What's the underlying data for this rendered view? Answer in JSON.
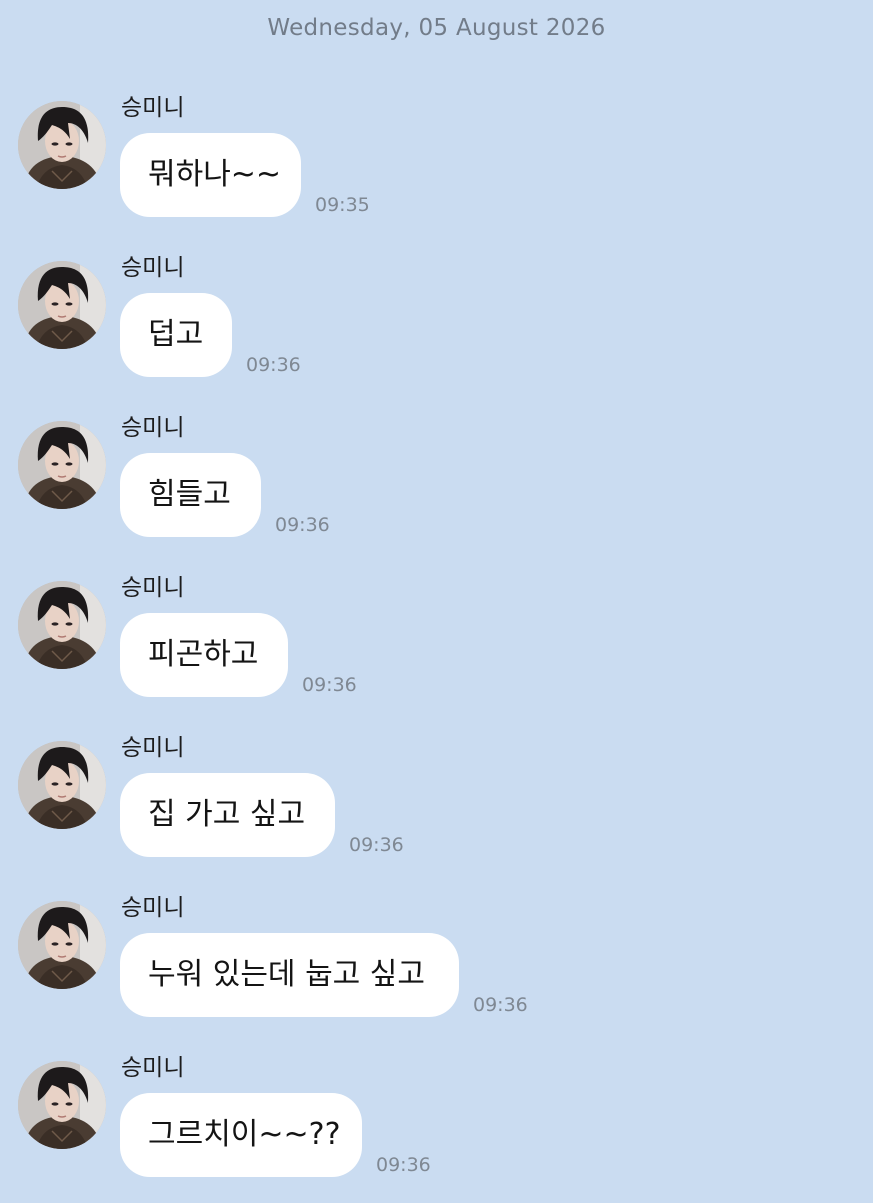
{
  "chat": {
    "date_label": "Wednesday, 05 August 2026",
    "messages": [
      {
        "sender": "승미니",
        "text": "뭐하나~~",
        "time": "09:35"
      },
      {
        "sender": "승미니",
        "text": "덥고",
        "time": "09:36"
      },
      {
        "sender": "승미니",
        "text": "힘들고",
        "time": "09:36"
      },
      {
        "sender": "승미니",
        "text": "피곤하고",
        "time": "09:36"
      },
      {
        "sender": "승미니",
        "text": "집 가고 싶고",
        "time": "09:36"
      },
      {
        "sender": "승미니",
        "text": "누워 있는데 눕고 싶고",
        "time": "09:36"
      },
      {
        "sender": "승미니",
        "text": "그르치이~~??",
        "time": "09:36"
      }
    ]
  },
  "colors": {
    "background": "#cadcf1",
    "bubble": "#ffffff",
    "timestamp": "#7f8893",
    "date_label": "#727c89"
  },
  "icons": {
    "avatar": "profile-photo-avatar"
  }
}
